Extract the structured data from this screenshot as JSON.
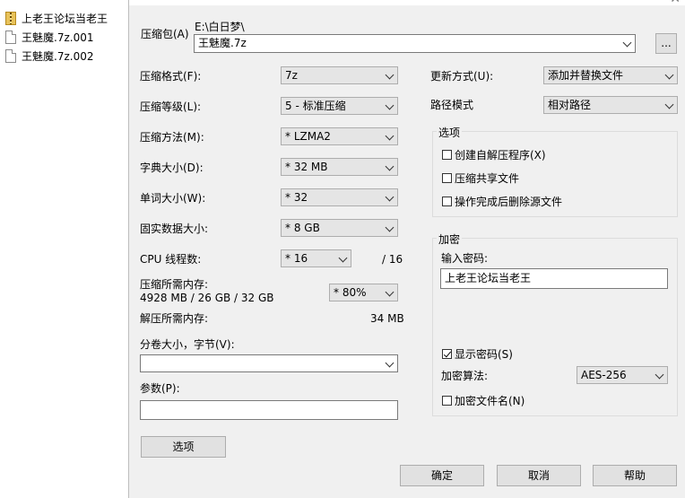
{
  "explorer": {
    "files": [
      {
        "name": "上老王论坛当老王",
        "icon": "zip-folder-icon"
      },
      {
        "name": "王魅魔.7z.001",
        "icon": "file-icon"
      },
      {
        "name": "王魅魔.7z.002",
        "icon": "file-icon"
      }
    ]
  },
  "dialog": {
    "archive": {
      "label": "压缩包(A)",
      "path": "E:\\白日梦\\",
      "value": "王魅魔.7z",
      "browse_label": "..."
    },
    "format": {
      "label": "压缩格式(F):",
      "value": "7z"
    },
    "level": {
      "label": "压缩等级(L):",
      "value": "5 - 标准压缩"
    },
    "method": {
      "label": "压缩方法(M):",
      "value": "* LZMA2"
    },
    "dict": {
      "label": "字典大小(D):",
      "value": "* 32 MB"
    },
    "word": {
      "label": "单词大小(W):",
      "value": "* 32"
    },
    "solid": {
      "label": "固实数据大小:",
      "value": "* 8 GB"
    },
    "threads": {
      "label": "CPU 线程数:",
      "value": "* 16",
      "max": "/ 16"
    },
    "mem_compress": {
      "label": "压缩所需内存:",
      "detail": "4928 MB / 26 GB / 32 GB",
      "value": "* 80%"
    },
    "mem_decompress": {
      "label": "解压所需内存:",
      "value": "34 MB"
    },
    "volume": {
      "label": "分卷大小，字节(V):",
      "value": ""
    },
    "params": {
      "label": "参数(P):",
      "value": ""
    },
    "options_button": "选项",
    "update": {
      "label": "更新方式(U):",
      "value": "添加并替换文件"
    },
    "path_mode": {
      "label": "路径模式",
      "value": "相对路径"
    },
    "options_group": {
      "title": "选项",
      "items": [
        {
          "label": "创建自解压程序(X)",
          "checked": false
        },
        {
          "label": "压缩共享文件",
          "checked": false
        },
        {
          "label": "操作完成后删除源文件",
          "checked": false
        }
      ]
    },
    "encryption": {
      "title": "加密",
      "password_label": "输入密码:",
      "password_value": "上老王论坛当老王",
      "show_password": {
        "label": "显示密码(S)",
        "checked": true
      },
      "method_label": "加密算法:",
      "method_value": "AES-256",
      "encrypt_names": {
        "label": "加密文件名(N)",
        "checked": false
      }
    },
    "buttons": {
      "ok": "确定",
      "cancel": "取消",
      "help": "帮助"
    }
  }
}
